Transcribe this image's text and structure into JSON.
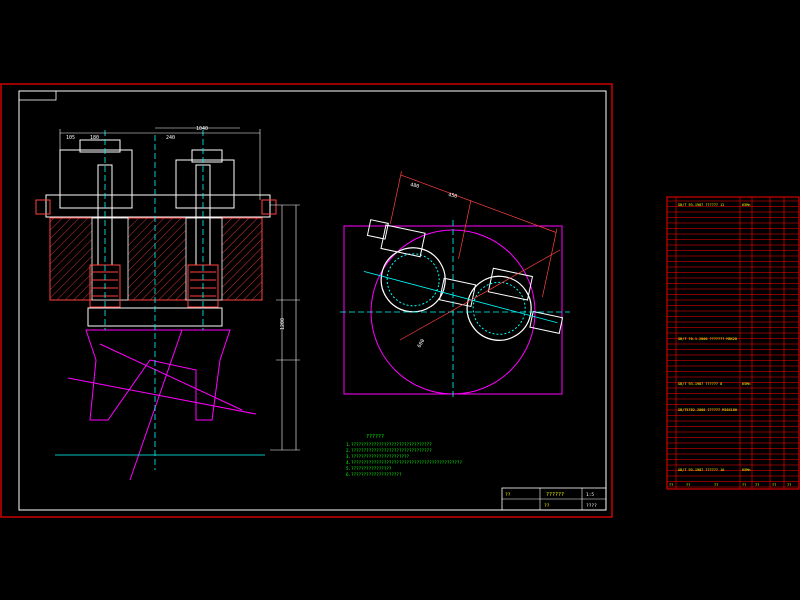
{
  "colors": {
    "background": "#000000",
    "frame": "#ff0000",
    "geometry": "#ffffff",
    "centerline": "#ff00ff",
    "hatch": "#ff4040",
    "dimension": "#ffffff",
    "axis_cyan": "#00ffff",
    "notes_green": "#00ff00",
    "yellow": "#ffff00"
  },
  "notes": {
    "heading": "??????",
    "lines": [
      "1.????????????????????????????????",
      "2.????????????????????????????????",
      "3.???????????????????????",
      "4.????????????????????????????????????????????",
      "5.????????????????",
      "6.????????????????????"
    ]
  },
  "title_block": {
    "title": "??????",
    "scale": "1:5",
    "sheet": "????",
    "drawn_by": "??",
    "checked_by": "??"
  },
  "bom": {
    "rows": [
      {
        "text": "GB/T 93-1987 ?????? 12",
        "note": "65Mn"
      },
      {
        "text": "GB/T 70.1-2000 ??????? M8X20",
        "note": ""
      },
      {
        "text": "GB/T 93-1987 ?????? 8",
        "note": "65Mn"
      },
      {
        "text": "GB/T5782-2000 ?????? M16X100",
        "note": ""
      },
      {
        "text": "GB/T 93-1987 ?????? 16",
        "note": "65Mn"
      }
    ],
    "header": [
      "??",
      "??",
      "??",
      "??",
      "??",
      "??",
      "??"
    ]
  },
  "dims": {
    "top_overall": "1040",
    "left_a": "105",
    "left_b": "180",
    "mid": "240",
    "height_total": "1200",
    "plan_a": "450",
    "plan_b": "480",
    "bore": "600"
  }
}
